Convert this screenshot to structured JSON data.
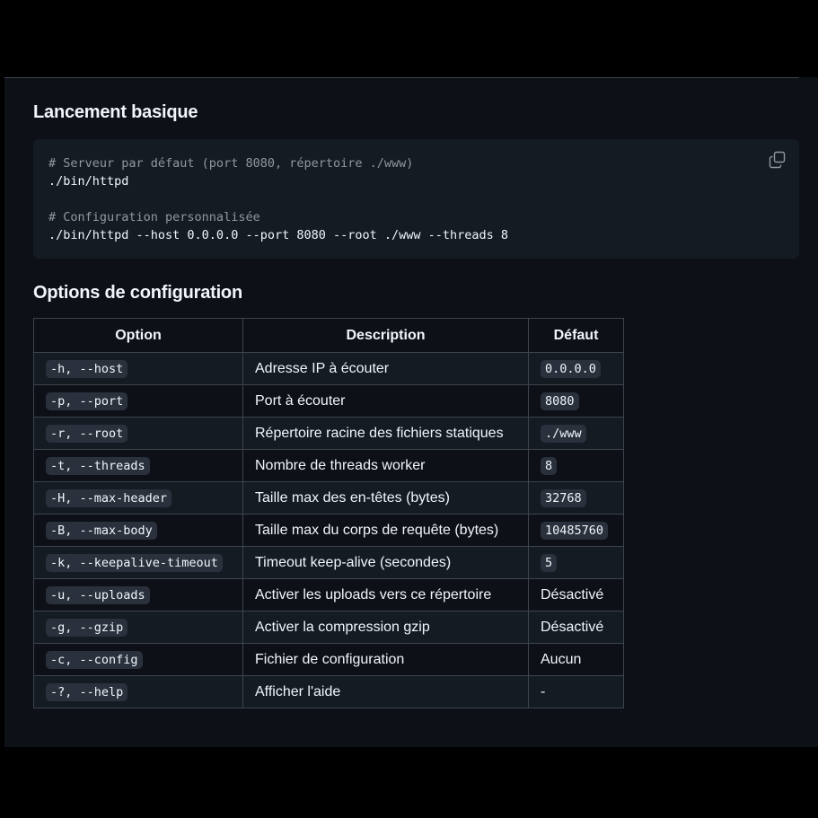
{
  "sections": {
    "basic_title": "Lancement basique",
    "options_title": "Options de configuration"
  },
  "code": {
    "lines": [
      {
        "kind": "comment",
        "text": "# Serveur par défaut (port 8080, répertoire ./www)"
      },
      {
        "kind": "command",
        "text": "./bin/httpd"
      },
      {
        "kind": "blank",
        "text": ""
      },
      {
        "kind": "comment",
        "text": "# Configuration personnalisée"
      },
      {
        "kind": "command",
        "text": "./bin/httpd --host 0.0.0.0 --port 8080 --root ./www --threads 8"
      }
    ],
    "copy_icon": "copy-icon"
  },
  "table": {
    "headers": [
      "Option",
      "Description",
      "Défaut"
    ],
    "rows": [
      {
        "option": "-h, --host",
        "description": "Adresse IP à écouter",
        "default": "0.0.0.0",
        "default_code": true
      },
      {
        "option": "-p, --port",
        "description": "Port à écouter",
        "default": "8080",
        "default_code": true
      },
      {
        "option": "-r, --root",
        "description": "Répertoire racine des fichiers statiques",
        "default": "./www",
        "default_code": true
      },
      {
        "option": "-t, --threads",
        "description": "Nombre de threads worker",
        "default": "8",
        "default_code": true
      },
      {
        "option": "-H, --max-header",
        "description": "Taille max des en-têtes (bytes)",
        "default": "32768",
        "default_code": true
      },
      {
        "option": "-B, --max-body",
        "description": "Taille max du corps de requête (bytes)",
        "default": "10485760",
        "default_code": true
      },
      {
        "option": "-k, --keepalive-timeout",
        "description": "Timeout keep-alive (secondes)",
        "default": "5",
        "default_code": true
      },
      {
        "option": "-u, --uploads",
        "description": "Activer les uploads vers ce répertoire",
        "default": "Désactivé",
        "default_code": false
      },
      {
        "option": "-g, --gzip",
        "description": "Activer la compression gzip",
        "default": "Désactivé",
        "default_code": false
      },
      {
        "option": "-c, --config",
        "description": "Fichier de configuration",
        "default": "Aucun",
        "default_code": false
      },
      {
        "option": "-?, --help",
        "description": "Afficher l'aide",
        "default": "-",
        "default_code": false
      }
    ]
  },
  "colors": {
    "background": "#0d1117",
    "code_bg": "#151b23",
    "border": "#3d444d",
    "text": "#f0f6fc",
    "muted": "#9198a1"
  }
}
